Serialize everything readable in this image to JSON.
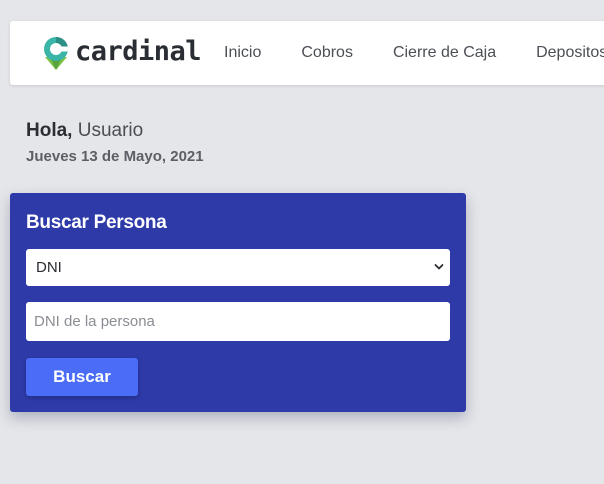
{
  "brand": {
    "name": "cardinal",
    "colors": {
      "teal": "#3ab5a8",
      "dark_teal": "#2e8f86",
      "green": "#7cc242",
      "text": "#2a2d33"
    }
  },
  "nav": {
    "items": [
      {
        "label": "Inicio"
      },
      {
        "label": "Cobros"
      },
      {
        "label": "Cierre de Caja"
      },
      {
        "label": "Depositos"
      }
    ]
  },
  "greeting": {
    "hello": "Hola,",
    "user": "Usuario",
    "date": "Jueves 13 de Mayo, 2021"
  },
  "search_card": {
    "title": "Buscar Persona",
    "document_type": {
      "selected": "DNI"
    },
    "input": {
      "value": "",
      "placeholder": "DNI de la persona"
    },
    "button_label": "Buscar",
    "colors": {
      "card_bg": "#2d3aa8",
      "button_bg": "#4a6cf7"
    }
  }
}
